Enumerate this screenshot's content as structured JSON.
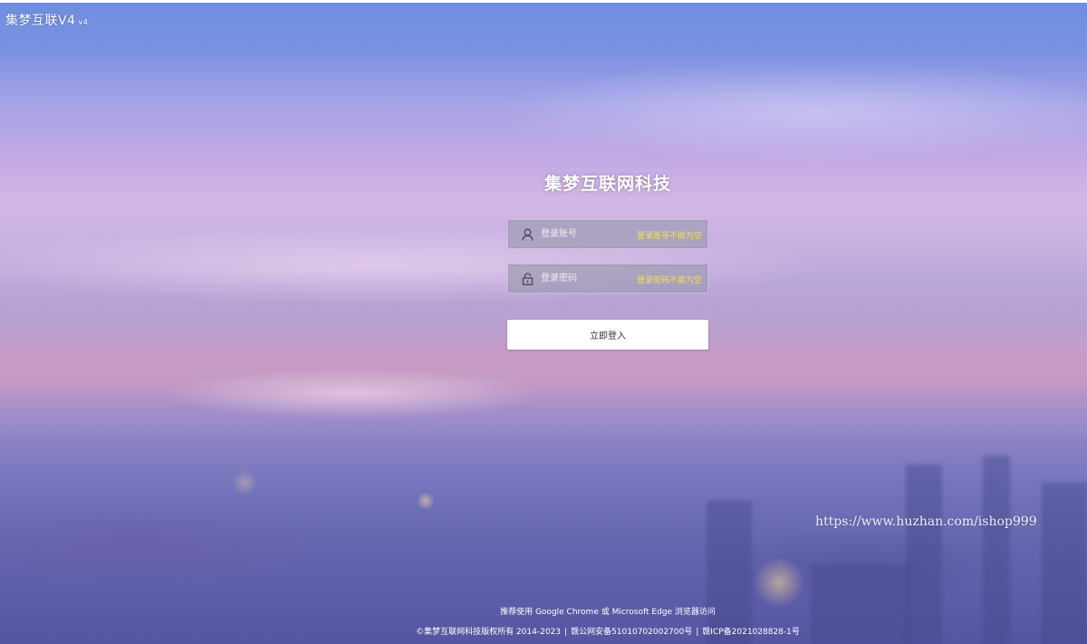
{
  "brand": {
    "logo_text": "集梦互联V4",
    "version_badge": "v4"
  },
  "login": {
    "title": "集梦互联网科技",
    "account": {
      "placeholder": "登录账号",
      "error": "登录账号不能为空",
      "icon": "user-icon"
    },
    "password": {
      "placeholder": "登录密码",
      "error": "登录密码不能为空",
      "icon": "lock-icon"
    },
    "submit_label": "立即登入"
  },
  "footer": {
    "browser_tip": "推荐使用 Google Chrome 或 Microsoft Edge 浏览器访问",
    "copyright": "©集梦互联网科技版权所有 2014-2023",
    "police_record": "赣公网安备51010702002700号",
    "icp_record": "赣ICP备2021028828-1号",
    "separator": "|"
  },
  "watermark": "https://www.huzhan.com/ishop999",
  "colors": {
    "error_text": "#f2e44a",
    "button_bg": "#ffffff",
    "sky_top": "#6e8ee0",
    "sky_horizon": "#c89bc6"
  }
}
